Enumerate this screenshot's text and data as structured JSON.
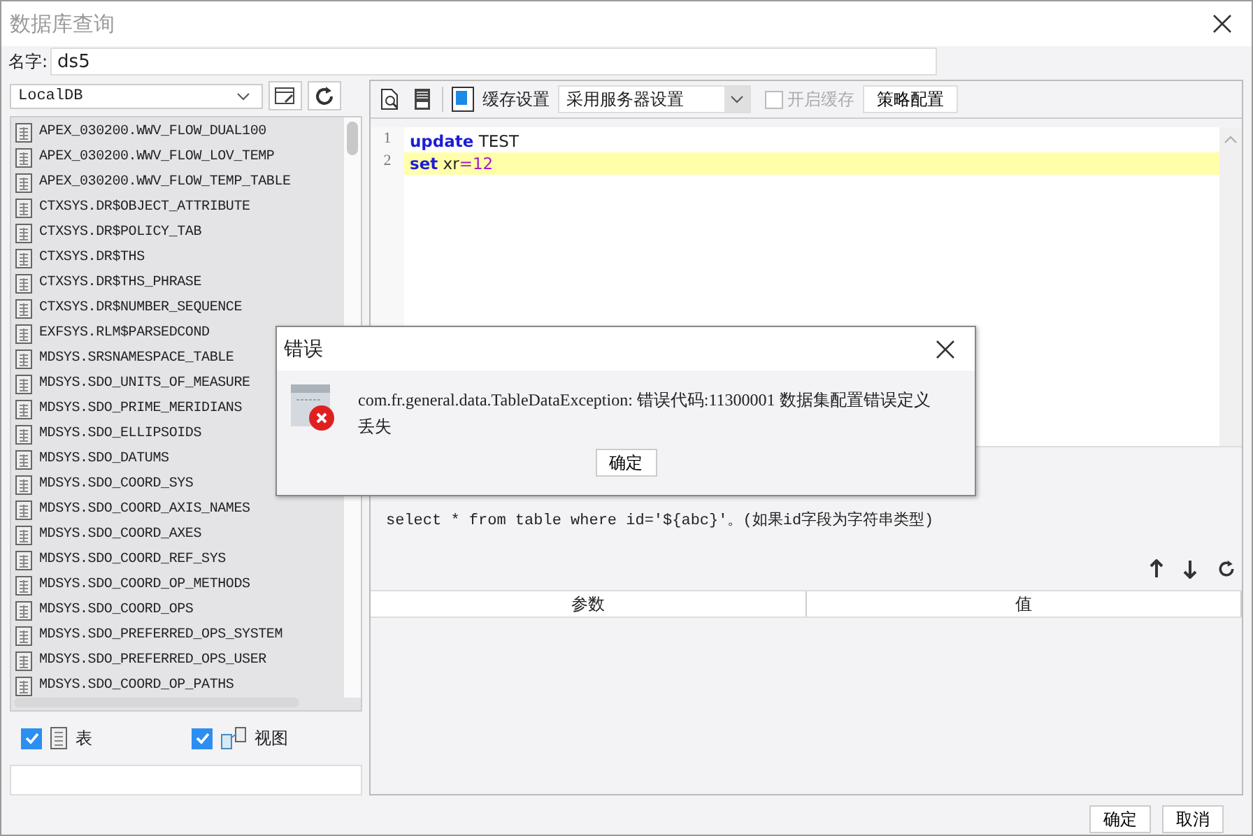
{
  "window": {
    "title": "数据库查询"
  },
  "name_field": {
    "label": "名字:",
    "value": "ds5"
  },
  "database": {
    "value": "LocalDB"
  },
  "tables": [
    "APEX_030200.WWV_FLOW_DUAL100",
    "APEX_030200.WWV_FLOW_LOV_TEMP",
    "APEX_030200.WWV_FLOW_TEMP_TABLE",
    "CTXSYS.DR$OBJECT_ATTRIBUTE",
    "CTXSYS.DR$POLICY_TAB",
    "CTXSYS.DR$THS",
    "CTXSYS.DR$THS_PHRASE",
    "CTXSYS.DR$NUMBER_SEQUENCE",
    "EXFSYS.RLM$PARSEDCOND",
    "MDSYS.SRSNAMESPACE_TABLE",
    "MDSYS.SDO_UNITS_OF_MEASURE",
    "MDSYS.SDO_PRIME_MERIDIANS",
    "MDSYS.SDO_ELLIPSOIDS",
    "MDSYS.SDO_DATUMS",
    "MDSYS.SDO_COORD_SYS",
    "MDSYS.SDO_COORD_AXIS_NAMES",
    "MDSYS.SDO_COORD_AXES",
    "MDSYS.SDO_COORD_REF_SYS",
    "MDSYS.SDO_COORD_OP_METHODS",
    "MDSYS.SDO_COORD_OPS",
    "MDSYS.SDO_PREFERRED_OPS_SYSTEM",
    "MDSYS.SDO_PREFERRED_OPS_USER",
    "MDSYS.SDO_COORD_OP_PATHS"
  ],
  "filters": [
    {
      "label": "表",
      "checked": true,
      "kind": "table"
    },
    {
      "label": "视图",
      "checked": true,
      "kind": "view"
    }
  ],
  "toolbar": {
    "cache_label": "缓存设置",
    "cache_select": "采用服务器设置",
    "enable_cache": {
      "label": "开启缓存",
      "checked": false,
      "disabled": true
    },
    "strategy_button": "策略配置"
  },
  "editor": {
    "lines": [
      {
        "number": "1",
        "current": false,
        "tokens": [
          {
            "kind": "keyword",
            "text": "update"
          },
          {
            "kind": "plain",
            "text": " TEST"
          }
        ]
      },
      {
        "number": "2",
        "current": true,
        "tokens": [
          {
            "kind": "keyword",
            "text": "set"
          },
          {
            "kind": "plain",
            "text": " xr"
          },
          {
            "kind": "number",
            "text": "=12"
          }
        ]
      }
    ]
  },
  "hints": [
    "select * from table where id='${abc}'。(如果id字段为字符串类型)"
  ],
  "param_table": {
    "columns": [
      "参数",
      "值"
    ]
  },
  "buttons": [
    "确定",
    "取消"
  ],
  "dialog": {
    "title": "错误",
    "message": "com.fr.general.data.TableDataException: 错误代码:11300001 数据集配置错误定义丢失",
    "button": "确定"
  }
}
